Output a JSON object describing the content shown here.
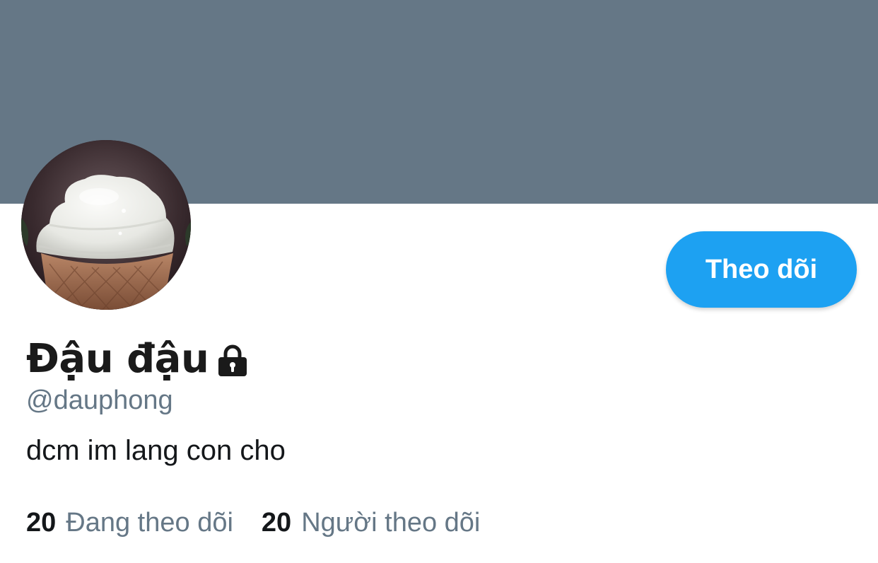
{
  "profile": {
    "display_name": "Đậu đậu",
    "handle": "@dauphong",
    "bio": "dcm im lang con cho",
    "protected_icon": "lock-icon"
  },
  "actions": {
    "follow_label": "Theo dõi"
  },
  "stats": {
    "following": {
      "count": "20",
      "label": "Đang theo dõi"
    },
    "followers": {
      "count": "20",
      "label": "Người theo dõi"
    }
  },
  "colors": {
    "banner": "#657786",
    "accent": "#1da1f2",
    "secondary_text": "#657786",
    "primary_text": "#14171a"
  }
}
